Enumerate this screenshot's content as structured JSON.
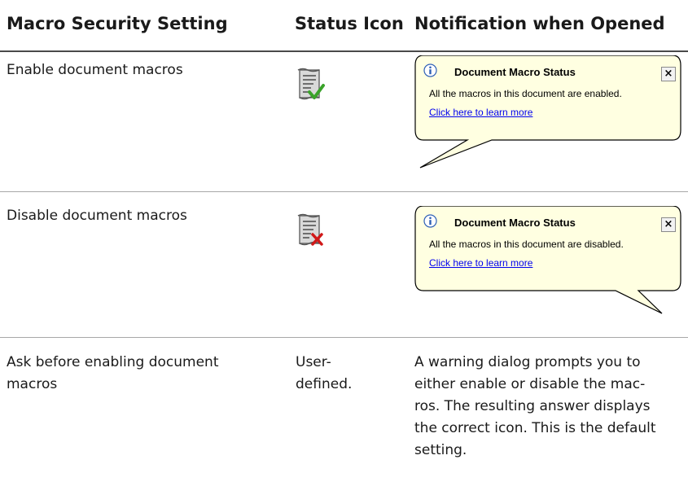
{
  "table": {
    "headers": [
      "Macro Security Setting",
      "Status Icon",
      "Notification when Opened"
    ],
    "rows": [
      {
        "setting": "Enable document macros",
        "status_icon": "macro-scroll-checkmark-icon",
        "notification": {
          "title": "Document Macro Status",
          "message": "All the macros in this document are enabled.",
          "link": "Click here to learn more",
          "close": "×"
        }
      },
      {
        "setting": "Disable document macros",
        "status_icon": "macro-scroll-red-x-icon",
        "notification": {
          "title": "Document Macro Status",
          "message": "All the macros in this document are disabled.",
          "link": "Click here to learn more",
          "close": "×"
        }
      },
      {
        "setting_lines": [
          "Ask before enabling document",
          "macros"
        ],
        "status_lines": [
          "User-",
          "defined."
        ],
        "notification_lines": [
          "A warning dialog prompts you to",
          "either enable or disable the mac-",
          "ros. The resulting answer displays",
          "the correct icon. This is the default",
          "setting."
        ]
      }
    ]
  },
  "colors": {
    "balloon_fill": "#ffffe1",
    "link": "#0000ee",
    "check_green": "#3aa32a",
    "x_red": "#d01818"
  }
}
